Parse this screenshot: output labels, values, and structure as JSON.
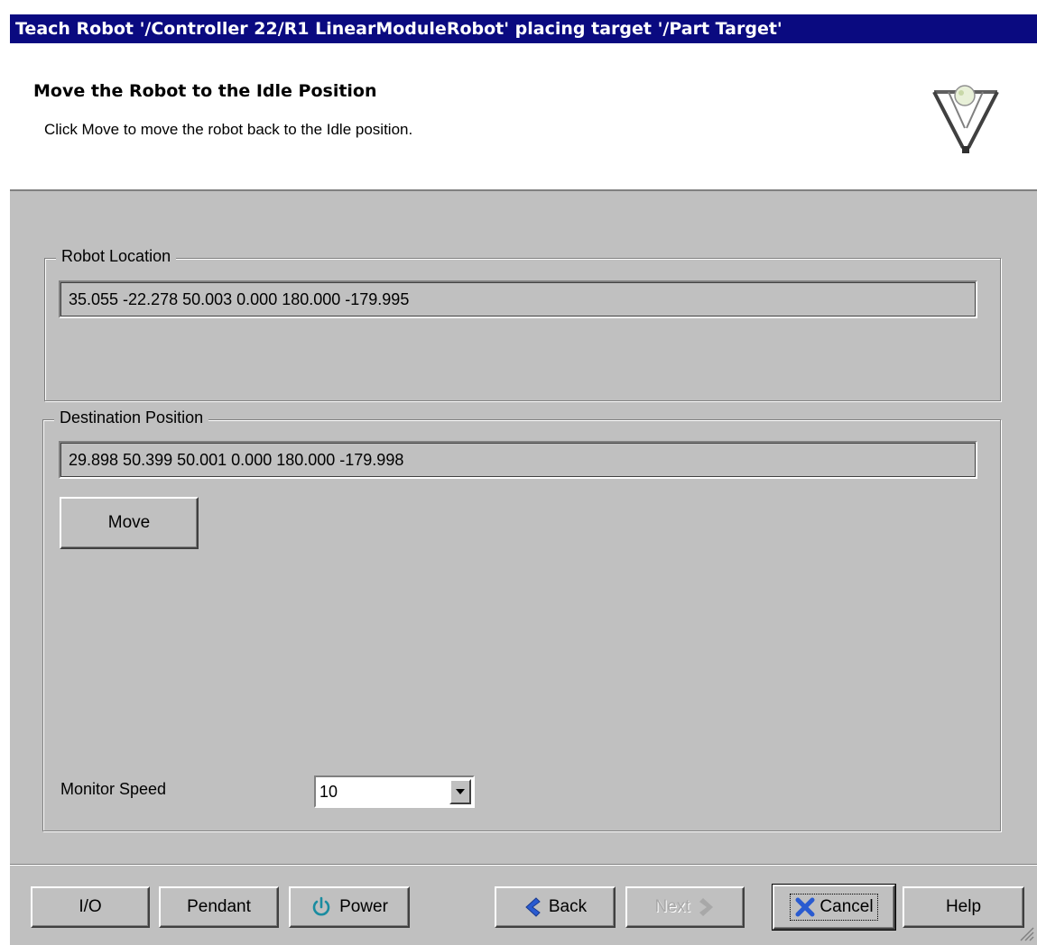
{
  "window": {
    "title": "Teach Robot '/Controller 22/R1 LinearModuleRobot' placing target '/Part Target'"
  },
  "header": {
    "title": "Move the Robot to the Idle Position",
    "description": "Click Move to move the robot back to the Idle position.",
    "logo_icon": "delta-robot-icon"
  },
  "robot_location": {
    "label": "Robot Location",
    "value": "35.055 -22.278 50.003 0.000 180.000 -179.995"
  },
  "destination_position": {
    "label": "Destination Position",
    "value": "29.898 50.399 50.001 0.000 180.000 -179.998",
    "move_label": "Move"
  },
  "monitor_speed": {
    "label": "Monitor Speed",
    "value": "10"
  },
  "footer": {
    "io_label": "I/O",
    "pendant_label": "Pendant",
    "power_label": "Power",
    "back_label": "Back",
    "next_label": "Next",
    "cancel_label": "Cancel",
    "help_label": "Help"
  },
  "colors": {
    "titlebar": "#0a0a80",
    "dialog_face": "#c0c0c0",
    "power_icon": "#1a8ca0",
    "back_arrow": "#2a5bd0",
    "cancel_x": "#2a5bd0"
  }
}
